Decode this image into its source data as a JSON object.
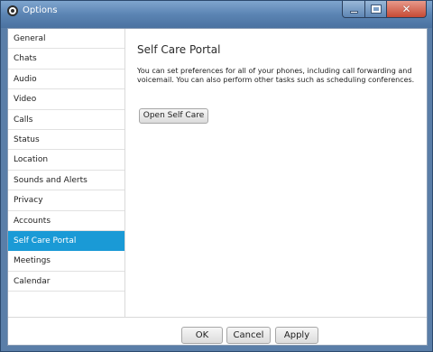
{
  "window": {
    "title": "Options"
  },
  "sidebar": {
    "items": [
      {
        "label": "General"
      },
      {
        "label": "Chats"
      },
      {
        "label": "Audio"
      },
      {
        "label": "Video"
      },
      {
        "label": "Calls"
      },
      {
        "label": "Status"
      },
      {
        "label": "Location"
      },
      {
        "label": "Sounds and Alerts"
      },
      {
        "label": "Privacy"
      },
      {
        "label": "Accounts"
      },
      {
        "label": "Self Care Portal",
        "selected": true
      },
      {
        "label": "Meetings"
      },
      {
        "label": "Calendar"
      }
    ]
  },
  "main": {
    "heading": "Self Care Portal",
    "description": "You can set preferences for all of your phones, including call forwarding and voicemail. You can also perform other tasks such as scheduling conferences.",
    "open_button": "Open Self Care"
  },
  "footer": {
    "ok": "OK",
    "cancel": "Cancel",
    "apply": "Apply"
  },
  "colors": {
    "selected": "#1a9ad6",
    "titlebar": "#5b84b3",
    "close": "#c54a35"
  },
  "icons": {
    "app": "app-logo-icon",
    "minimize": "minimize-icon",
    "maximize": "maximize-icon",
    "close": "close-icon"
  }
}
